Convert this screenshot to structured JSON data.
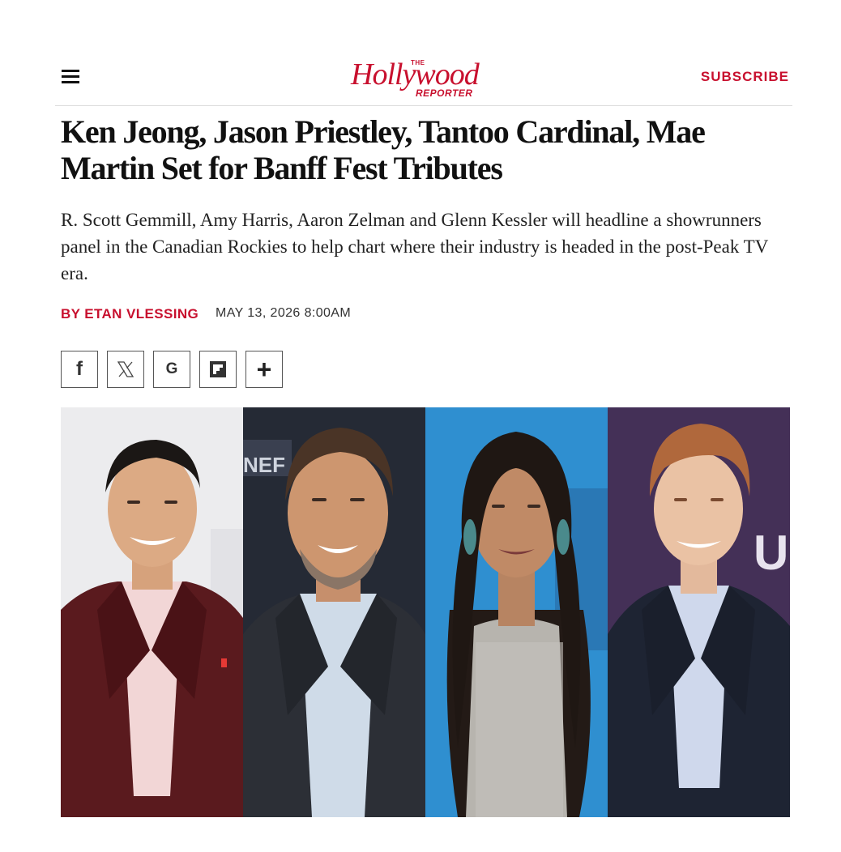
{
  "header": {
    "menu_icon": "hamburger-menu-icon",
    "logo": {
      "the": "THE",
      "main": "Hollywood",
      "reporter": "REPORTER"
    },
    "subscribe_label": "SUBSCRIBE"
  },
  "article": {
    "headline": "Ken Jeong, Jason Priestley, Tantoo Cardinal, Mae Martin Set for Banff Fest Tributes",
    "dek": "R. Scott Gemmill, Amy Harris, Aaron Zelman and Glenn Kessler will headline a showrunners panel in the Canadian Rockies to help chart where their industry is headed in the post-Peak TV era.",
    "byline": "BY ETAN VLESSING",
    "date": "MAY 13, 2026 8:00AM"
  },
  "share_buttons": [
    {
      "icon": "facebook-icon",
      "glyph": "f"
    },
    {
      "icon": "x-icon",
      "glyph": "𝕏"
    },
    {
      "icon": "google-icon",
      "glyph": "G"
    },
    {
      "icon": "flipboard-icon",
      "glyph": ""
    },
    {
      "icon": "plus-icon",
      "glyph": "+"
    }
  ],
  "photo": {
    "backdrop_text": [
      "NEF",
      "U"
    ]
  },
  "colors": {
    "accent": "#c8102e",
    "text": "#111111",
    "divider": "#dcdcdc"
  }
}
